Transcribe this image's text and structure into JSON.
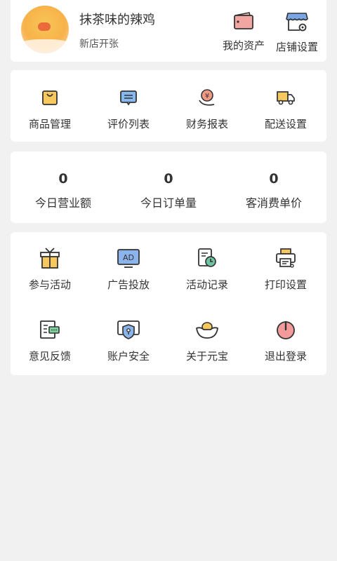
{
  "profile": {
    "shop_name": "抹茶味的辣鸡",
    "status": "新店开张"
  },
  "top_actions": [
    {
      "label": "我的资产",
      "icon": "wallet-icon"
    },
    {
      "label": "店铺设置",
      "icon": "store-settings-icon"
    }
  ],
  "quick_menu": [
    {
      "label": "商品管理",
      "icon": "product-bag-icon"
    },
    {
      "label": "评价列表",
      "icon": "comment-list-icon"
    },
    {
      "label": "财务报表",
      "icon": "finance-icon"
    },
    {
      "label": "配送设置",
      "icon": "delivery-truck-icon"
    }
  ],
  "stats": [
    {
      "value": "0",
      "label": "今日营业额"
    },
    {
      "value": "0",
      "label": "今日订单量"
    },
    {
      "value": "0",
      "label": "客消费单价"
    }
  ],
  "tools": [
    {
      "label": "参与活动",
      "icon": "gift-icon"
    },
    {
      "label": "广告投放",
      "icon": "ad-icon",
      "text": "AD"
    },
    {
      "label": "活动记录",
      "icon": "activity-record-icon"
    },
    {
      "label": "打印设置",
      "icon": "printer-icon"
    },
    {
      "label": "意见反馈",
      "icon": "feedback-icon"
    },
    {
      "label": "账户安全",
      "icon": "security-shield-icon"
    },
    {
      "label": "关于元宝",
      "icon": "ingot-icon"
    },
    {
      "label": "退出登录",
      "icon": "power-icon"
    }
  ],
  "colors": {
    "background": "#f1f1f1",
    "card": "#ffffff",
    "text": "#333333"
  }
}
